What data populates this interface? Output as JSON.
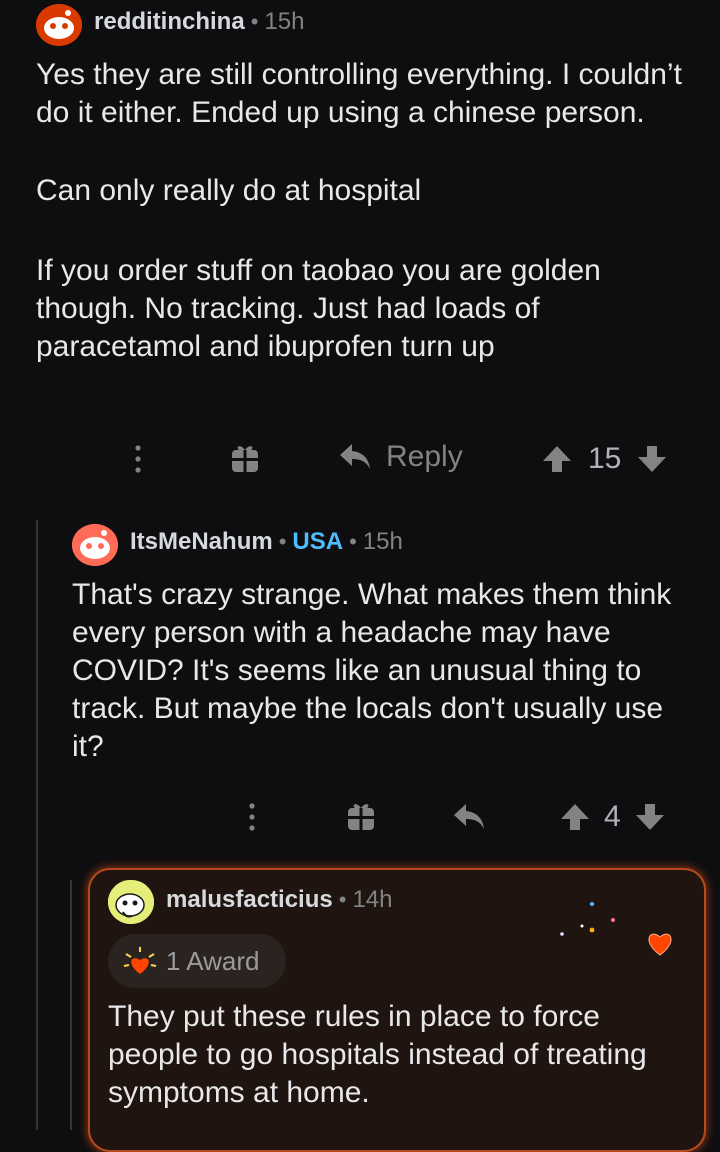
{
  "comments": [
    {
      "author": "redditinchina",
      "time": "15h",
      "paragraphs": [
        "Yes they are still controlling everything. I couldn’t do it either. Ended up using a chinese person.",
        "Can only really do at hospital",
        "If you order stuff on taobao you are golden though. No tracking. Just had loads of paracetamol and ibuprofen turn up"
      ],
      "actions": {
        "reply_label": "Reply",
        "score": "15"
      }
    },
    {
      "author": "ItsMeNahum",
      "flair": "USA",
      "time": "15h",
      "body": "That's crazy strange. What makes them think every person with a headache may have COVID? It's seems like an unusual thing to track. But maybe the locals don't usually use it?",
      "actions": {
        "score": "4"
      }
    },
    {
      "author": "malusfacticius",
      "time": "14h",
      "award": "1 Award",
      "body": "They put these rules in place to force people to go hospitals instead of treating symptoms at home."
    }
  ],
  "icons": {
    "more": "more-icon",
    "award": "gift-icon",
    "reply": "reply-arrow-icon",
    "upvote": "upvote-icon",
    "downvote": "downvote-icon",
    "avatar": "snoo-avatar-icon",
    "award_badge": "heart-award-icon"
  },
  "colors": {
    "background": "#0e0e10",
    "text": "#d7dadc",
    "muted": "#818384",
    "flair": "#4fbcff",
    "highlight_border": "#b64b1d"
  }
}
